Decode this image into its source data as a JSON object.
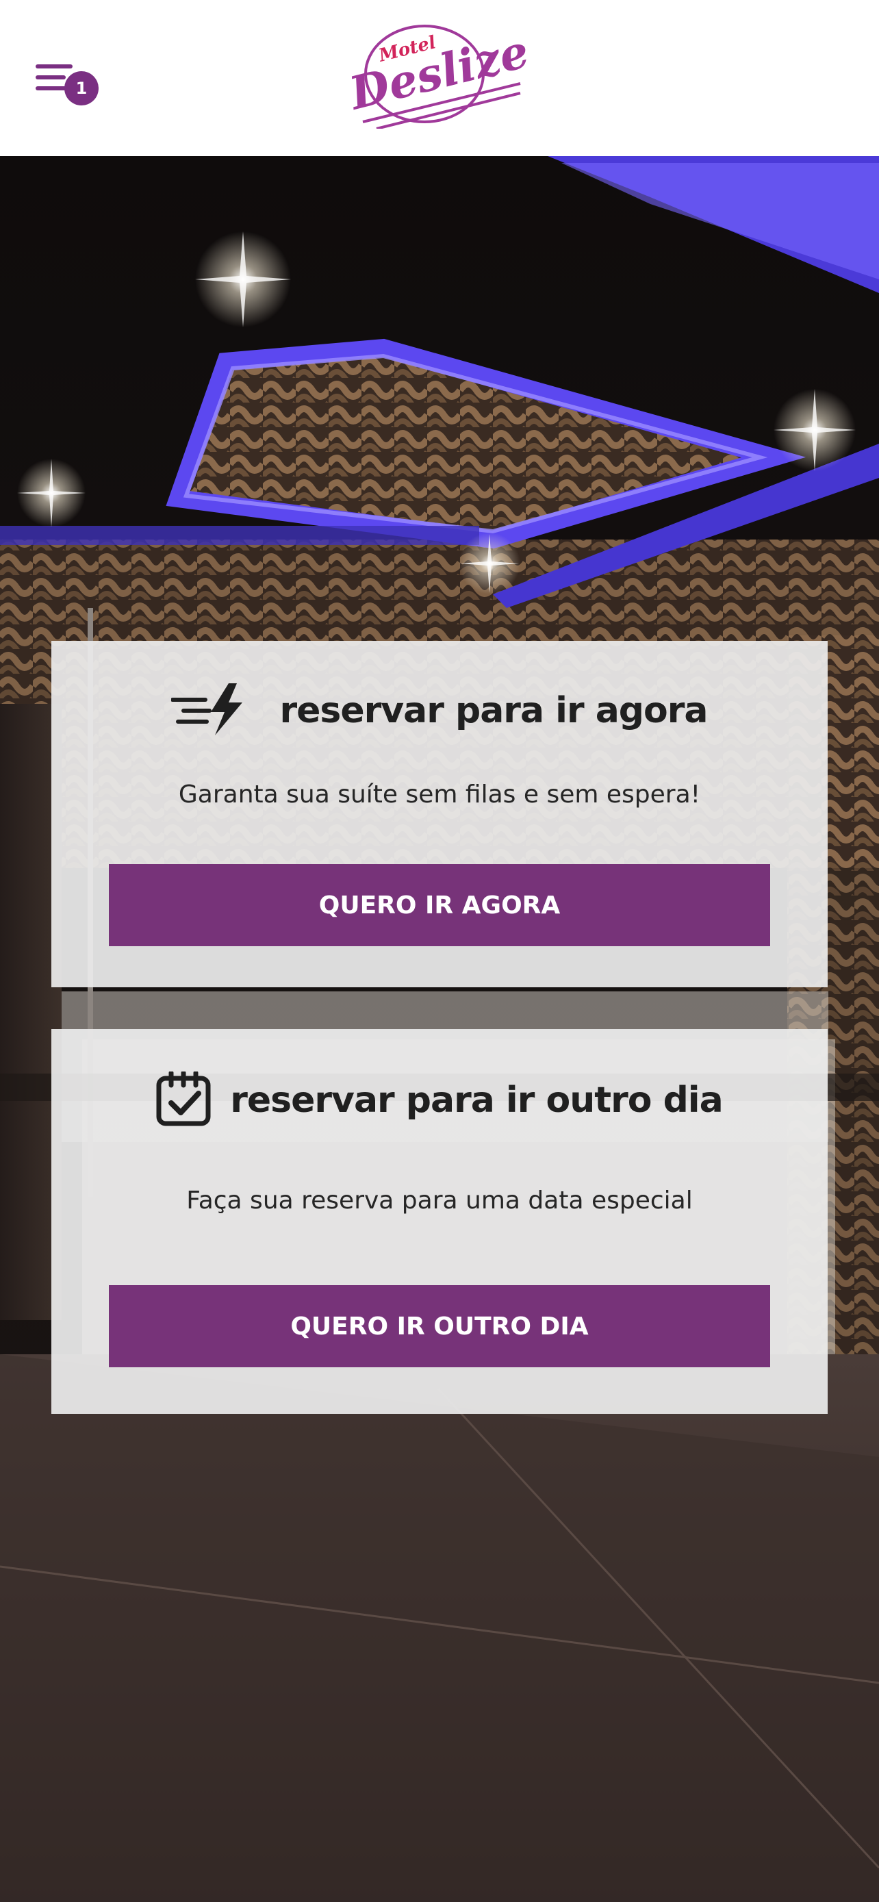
{
  "header": {
    "menu_badge_count": "1",
    "logo": {
      "small_text": "Motel",
      "brand_text": "Deslize",
      "brand_color": "#a0399a",
      "accent_color": "#d2245a"
    }
  },
  "cards": {
    "now": {
      "icon": "lightning-fast-icon",
      "title": "reservar para ir agora",
      "subtitle": "Garanta sua suíte sem filas e sem espera!",
      "button_label": "QUERO IR AGORA"
    },
    "later": {
      "icon": "calendar-check-icon",
      "title": "reservar para ir outro dia",
      "subtitle": "Faça sua reserva para uma data especial",
      "button_label": "QUERO IR OUTRO DIA"
    }
  },
  "colors": {
    "primary": "#773379",
    "header_bg": "#ffffff",
    "card_bg": "#ececec",
    "text": "#202020"
  }
}
